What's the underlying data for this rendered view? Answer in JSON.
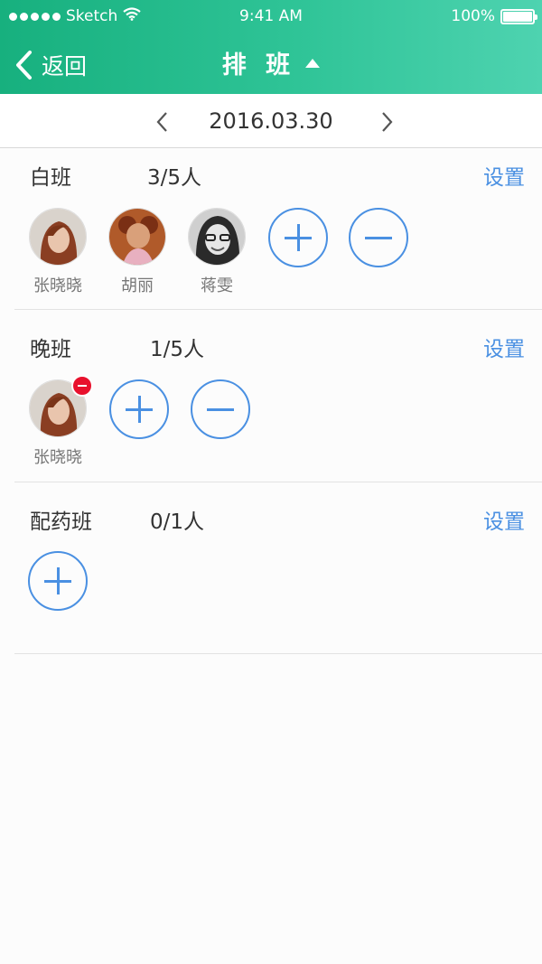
{
  "status_bar": {
    "carrier": "Sketch",
    "time": "9:41 AM",
    "battery": "100%"
  },
  "nav": {
    "back_label": "返回",
    "title": "排 班"
  },
  "date": {
    "current": "2016.03.30"
  },
  "shifts": [
    {
      "name": "白班",
      "count": "3/5人",
      "setting_label": "设置",
      "members": [
        {
          "name": "张晓晓"
        },
        {
          "name": "胡丽"
        },
        {
          "name": "蒋雯"
        }
      ]
    },
    {
      "name": "晚班",
      "count": "1/5人",
      "setting_label": "设置",
      "members": [
        {
          "name": "张晓晓"
        }
      ]
    },
    {
      "name": "配药班",
      "count": "0/1人",
      "setting_label": "设置",
      "members": []
    }
  ],
  "colors": {
    "header_gradient_start": "#17b07e",
    "header_gradient_end": "#4ed3b0",
    "accent_blue": "#4a90e2",
    "remove_red": "#e8112d"
  },
  "icons": [
    "wifi-icon",
    "battery-icon",
    "back-chevron-icon",
    "caret-up-icon",
    "chevron-left-icon",
    "chevron-right-icon",
    "plus-icon",
    "minus-icon",
    "remove-badge-icon"
  ]
}
